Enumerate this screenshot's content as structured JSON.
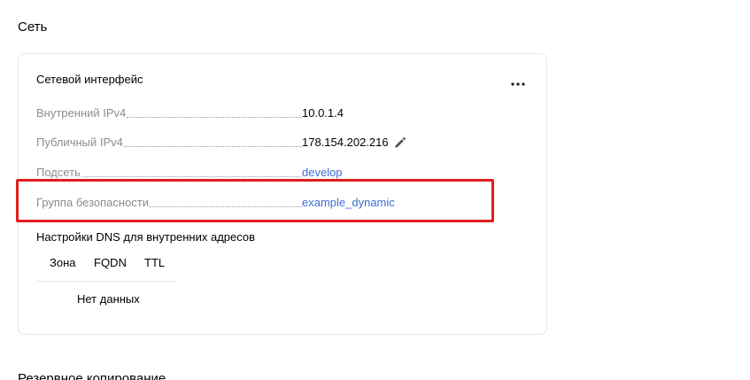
{
  "section": {
    "title": "Сеть"
  },
  "network_card": {
    "title": "Сетевой интерфейс",
    "menu_icon": "more-horizontal-icon",
    "properties": [
      {
        "key": "Внутренний IPv4",
        "value": "10.0.1.4",
        "type": "text"
      },
      {
        "key": "Публичный IPv4",
        "value": "178.154.202.216",
        "type": "text",
        "icon": "pencil-icon"
      },
      {
        "key": "Подсеть",
        "value": "develop",
        "type": "link"
      },
      {
        "key": "Группа безопасности",
        "value": "example_dynamic",
        "type": "link"
      }
    ],
    "dns": {
      "title": "Настройки DNS для внутренних адресов",
      "columns": [
        "Зона",
        "FQDN",
        "TTL"
      ],
      "empty_text": "Нет данных"
    }
  },
  "next_section": {
    "title": "Резервное копирование"
  },
  "colors": {
    "link": "#3d6fd6",
    "muted_label": "#8c8c8c",
    "highlight": "#e01e1e",
    "border": "#e5e5e5"
  }
}
